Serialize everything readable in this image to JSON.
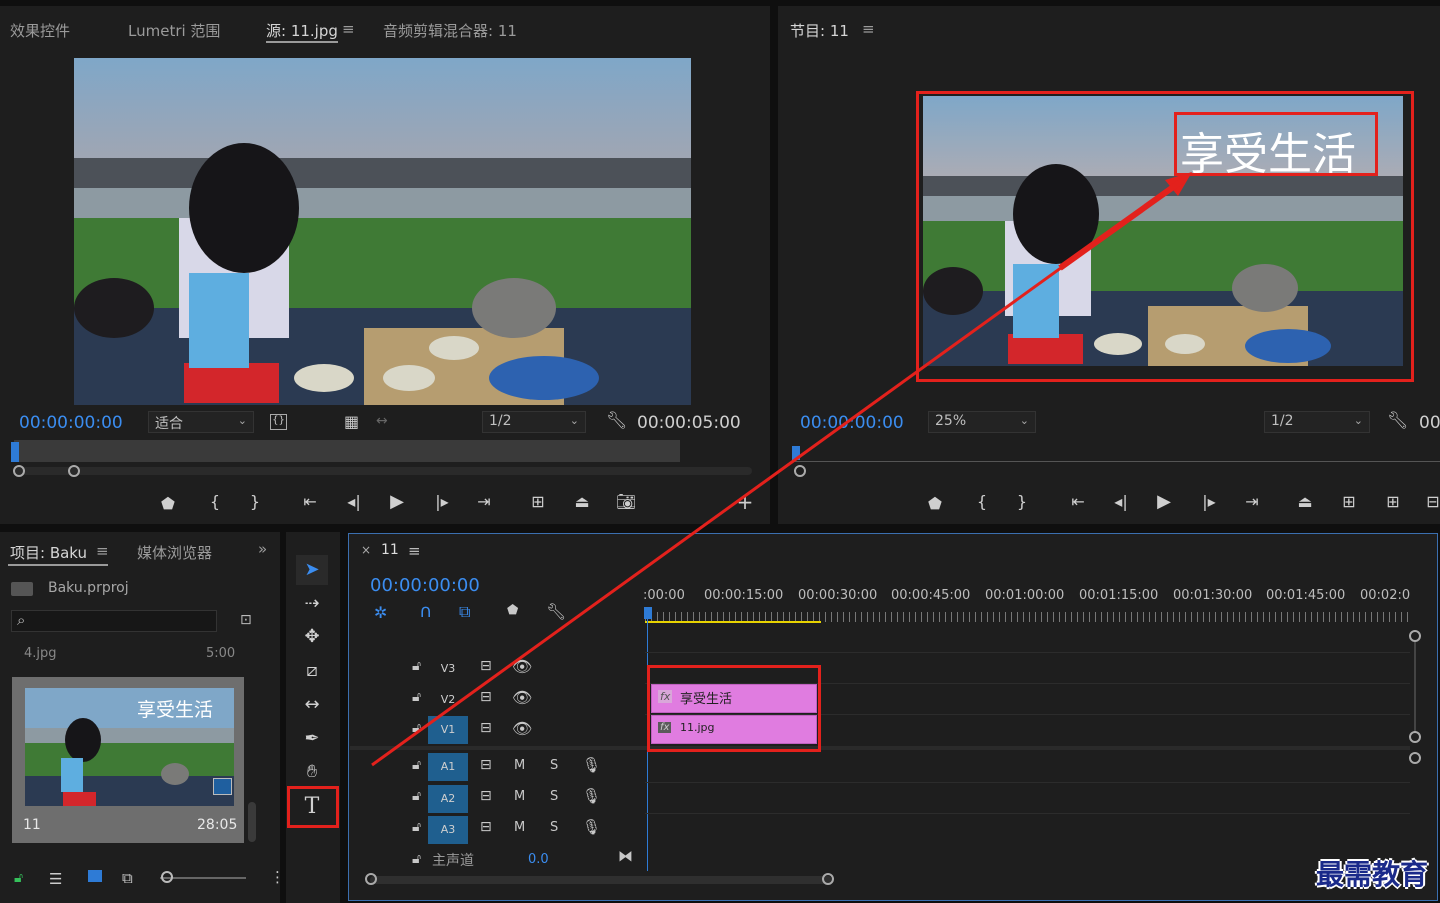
{
  "source_panel": {
    "tabs": [
      "效果控件",
      "Lumetri 范围",
      "源: 11.jpg",
      "音频剪辑混合器: 11"
    ],
    "timecode_in": "00:00:00:00",
    "fit_select": "适合",
    "resolution_select": "1/2",
    "timecode_duration": "00:00:05:00"
  },
  "program_panel": {
    "tab": "节目: 11",
    "timecode": "00:00:00:00",
    "zoom_select": "25%",
    "resolution_select": "1/2",
    "timecode_duration_partial": "00",
    "overlay_title": "享受生活"
  },
  "project_panel": {
    "tab_project": "项目: Baku",
    "tab_media": "媒体浏览器",
    "project_file": "Baku.prproj",
    "partial_item_name": "4.jpg",
    "partial_item_duration": "5:00",
    "thumb_title": "享受生活",
    "item_name": "11",
    "item_duration": "28:05"
  },
  "timeline": {
    "sequence_name": "11",
    "timecode": "00:00:00:00",
    "ruler": [
      ":00:00",
      "00:00:15:00",
      "00:00:30:00",
      "00:00:45:00",
      "00:01:00:00",
      "00:01:15:00",
      "00:01:30:00",
      "00:01:45:00",
      "00:02:0"
    ],
    "video_tracks": [
      "V3",
      "V2",
      "V1"
    ],
    "audio_tracks": [
      "A1",
      "A2",
      "A3"
    ],
    "mute_label": "M",
    "solo_label": "S",
    "master_label": "主声道",
    "master_value": "0.0",
    "clip_v2": "享受生活",
    "clip_v1": "11.jpg",
    "fx_label": "fx"
  },
  "watermark": "最需教育",
  "colors": {
    "accent": "#3b8df0",
    "highlight": "#e3211c",
    "clip": "#e07ce0"
  }
}
